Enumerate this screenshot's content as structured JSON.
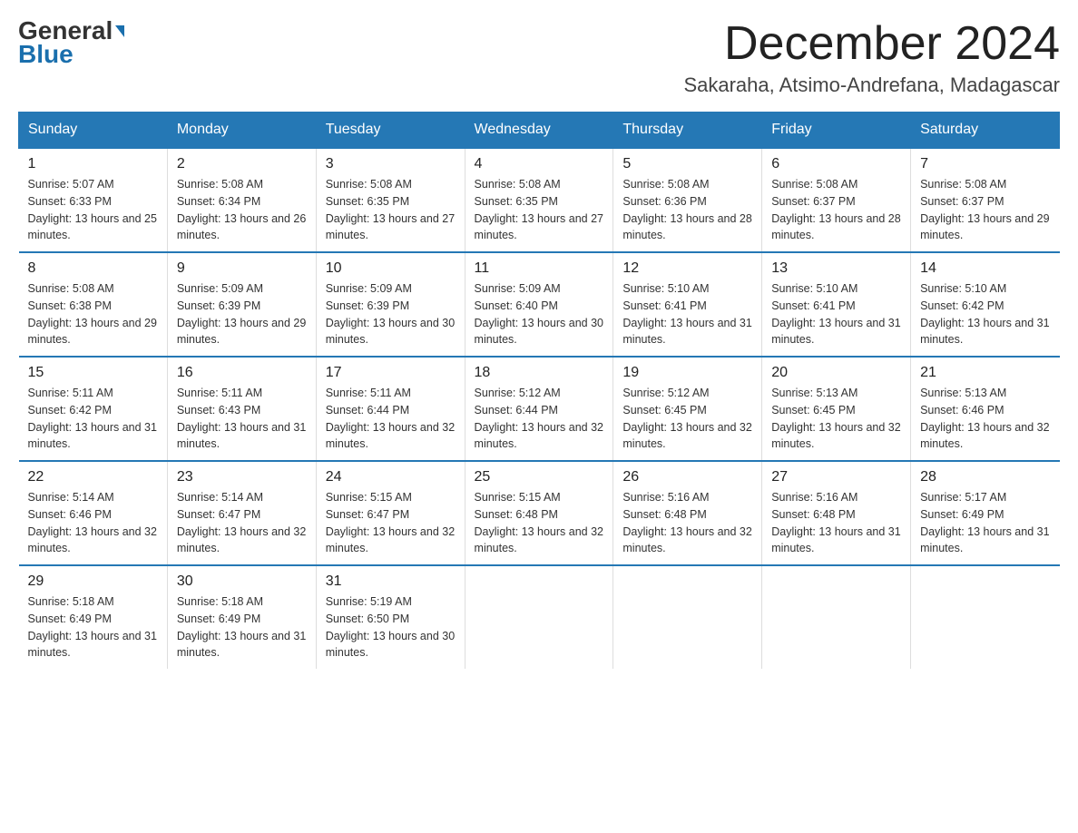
{
  "logo": {
    "line1_black": "General",
    "arrow": "▶",
    "line2_blue": "Blue"
  },
  "title": {
    "month": "December 2024",
    "location": "Sakaraha, Atsimo-Andrefana, Madagascar"
  },
  "header_days": [
    "Sunday",
    "Monday",
    "Tuesday",
    "Wednesday",
    "Thursday",
    "Friday",
    "Saturday"
  ],
  "weeks": [
    [
      {
        "day": "1",
        "sunrise": "5:07 AM",
        "sunset": "6:33 PM",
        "daylight": "13 hours and 25 minutes."
      },
      {
        "day": "2",
        "sunrise": "5:08 AM",
        "sunset": "6:34 PM",
        "daylight": "13 hours and 26 minutes."
      },
      {
        "day": "3",
        "sunrise": "5:08 AM",
        "sunset": "6:35 PM",
        "daylight": "13 hours and 27 minutes."
      },
      {
        "day": "4",
        "sunrise": "5:08 AM",
        "sunset": "6:35 PM",
        "daylight": "13 hours and 27 minutes."
      },
      {
        "day": "5",
        "sunrise": "5:08 AM",
        "sunset": "6:36 PM",
        "daylight": "13 hours and 28 minutes."
      },
      {
        "day": "6",
        "sunrise": "5:08 AM",
        "sunset": "6:37 PM",
        "daylight": "13 hours and 28 minutes."
      },
      {
        "day": "7",
        "sunrise": "5:08 AM",
        "sunset": "6:37 PM",
        "daylight": "13 hours and 29 minutes."
      }
    ],
    [
      {
        "day": "8",
        "sunrise": "5:08 AM",
        "sunset": "6:38 PM",
        "daylight": "13 hours and 29 minutes."
      },
      {
        "day": "9",
        "sunrise": "5:09 AM",
        "sunset": "6:39 PM",
        "daylight": "13 hours and 29 minutes."
      },
      {
        "day": "10",
        "sunrise": "5:09 AM",
        "sunset": "6:39 PM",
        "daylight": "13 hours and 30 minutes."
      },
      {
        "day": "11",
        "sunrise": "5:09 AM",
        "sunset": "6:40 PM",
        "daylight": "13 hours and 30 minutes."
      },
      {
        "day": "12",
        "sunrise": "5:10 AM",
        "sunset": "6:41 PM",
        "daylight": "13 hours and 31 minutes."
      },
      {
        "day": "13",
        "sunrise": "5:10 AM",
        "sunset": "6:41 PM",
        "daylight": "13 hours and 31 minutes."
      },
      {
        "day": "14",
        "sunrise": "5:10 AM",
        "sunset": "6:42 PM",
        "daylight": "13 hours and 31 minutes."
      }
    ],
    [
      {
        "day": "15",
        "sunrise": "5:11 AM",
        "sunset": "6:42 PM",
        "daylight": "13 hours and 31 minutes."
      },
      {
        "day": "16",
        "sunrise": "5:11 AM",
        "sunset": "6:43 PM",
        "daylight": "13 hours and 31 minutes."
      },
      {
        "day": "17",
        "sunrise": "5:11 AM",
        "sunset": "6:44 PM",
        "daylight": "13 hours and 32 minutes."
      },
      {
        "day": "18",
        "sunrise": "5:12 AM",
        "sunset": "6:44 PM",
        "daylight": "13 hours and 32 minutes."
      },
      {
        "day": "19",
        "sunrise": "5:12 AM",
        "sunset": "6:45 PM",
        "daylight": "13 hours and 32 minutes."
      },
      {
        "day": "20",
        "sunrise": "5:13 AM",
        "sunset": "6:45 PM",
        "daylight": "13 hours and 32 minutes."
      },
      {
        "day": "21",
        "sunrise": "5:13 AM",
        "sunset": "6:46 PM",
        "daylight": "13 hours and 32 minutes."
      }
    ],
    [
      {
        "day": "22",
        "sunrise": "5:14 AM",
        "sunset": "6:46 PM",
        "daylight": "13 hours and 32 minutes."
      },
      {
        "day": "23",
        "sunrise": "5:14 AM",
        "sunset": "6:47 PM",
        "daylight": "13 hours and 32 minutes."
      },
      {
        "day": "24",
        "sunrise": "5:15 AM",
        "sunset": "6:47 PM",
        "daylight": "13 hours and 32 minutes."
      },
      {
        "day": "25",
        "sunrise": "5:15 AM",
        "sunset": "6:48 PM",
        "daylight": "13 hours and 32 minutes."
      },
      {
        "day": "26",
        "sunrise": "5:16 AM",
        "sunset": "6:48 PM",
        "daylight": "13 hours and 32 minutes."
      },
      {
        "day": "27",
        "sunrise": "5:16 AM",
        "sunset": "6:48 PM",
        "daylight": "13 hours and 31 minutes."
      },
      {
        "day": "28",
        "sunrise": "5:17 AM",
        "sunset": "6:49 PM",
        "daylight": "13 hours and 31 minutes."
      }
    ],
    [
      {
        "day": "29",
        "sunrise": "5:18 AM",
        "sunset": "6:49 PM",
        "daylight": "13 hours and 31 minutes."
      },
      {
        "day": "30",
        "sunrise": "5:18 AM",
        "sunset": "6:49 PM",
        "daylight": "13 hours and 31 minutes."
      },
      {
        "day": "31",
        "sunrise": "5:19 AM",
        "sunset": "6:50 PM",
        "daylight": "13 hours and 30 minutes."
      },
      null,
      null,
      null,
      null
    ]
  ]
}
